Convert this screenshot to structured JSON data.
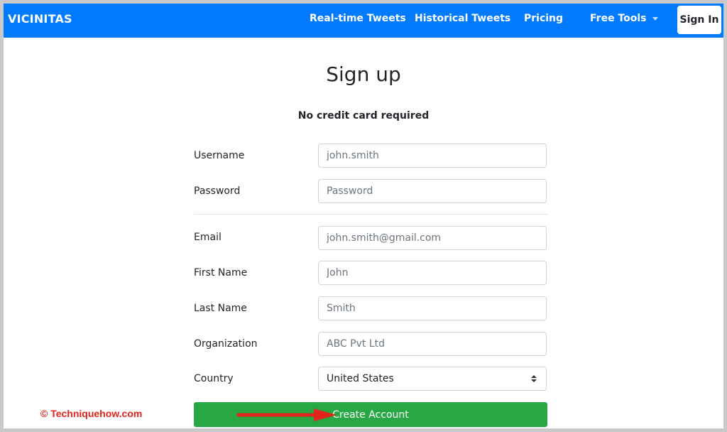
{
  "navbar": {
    "brand": "VICINITAS",
    "links": [
      "Real-time Tweets",
      "Historical Tweets",
      "Pricing",
      "Free Tools"
    ],
    "signin_label": "Sign In",
    "color": "#007bff"
  },
  "page": {
    "title": "Sign up",
    "subtitle": "No credit card required"
  },
  "form": {
    "username": {
      "label": "Username",
      "placeholder": "john.smith"
    },
    "password": {
      "label": "Password",
      "placeholder": "Password"
    },
    "email": {
      "label": "Email",
      "placeholder": "john.smith@gmail.com"
    },
    "first_name": {
      "label": "First Name",
      "placeholder": "John"
    },
    "last_name": {
      "label": "Last Name",
      "placeholder": "Smith"
    },
    "organization": {
      "label": "Organization",
      "placeholder": "ABC Pvt Ltd"
    },
    "country": {
      "label": "Country",
      "value": "United States"
    },
    "submit_label": "Create Account",
    "submit_color": "#28a745"
  },
  "watermark": "© Techniquehow.com",
  "annotation": {
    "arrow_color": "#e3241c"
  }
}
